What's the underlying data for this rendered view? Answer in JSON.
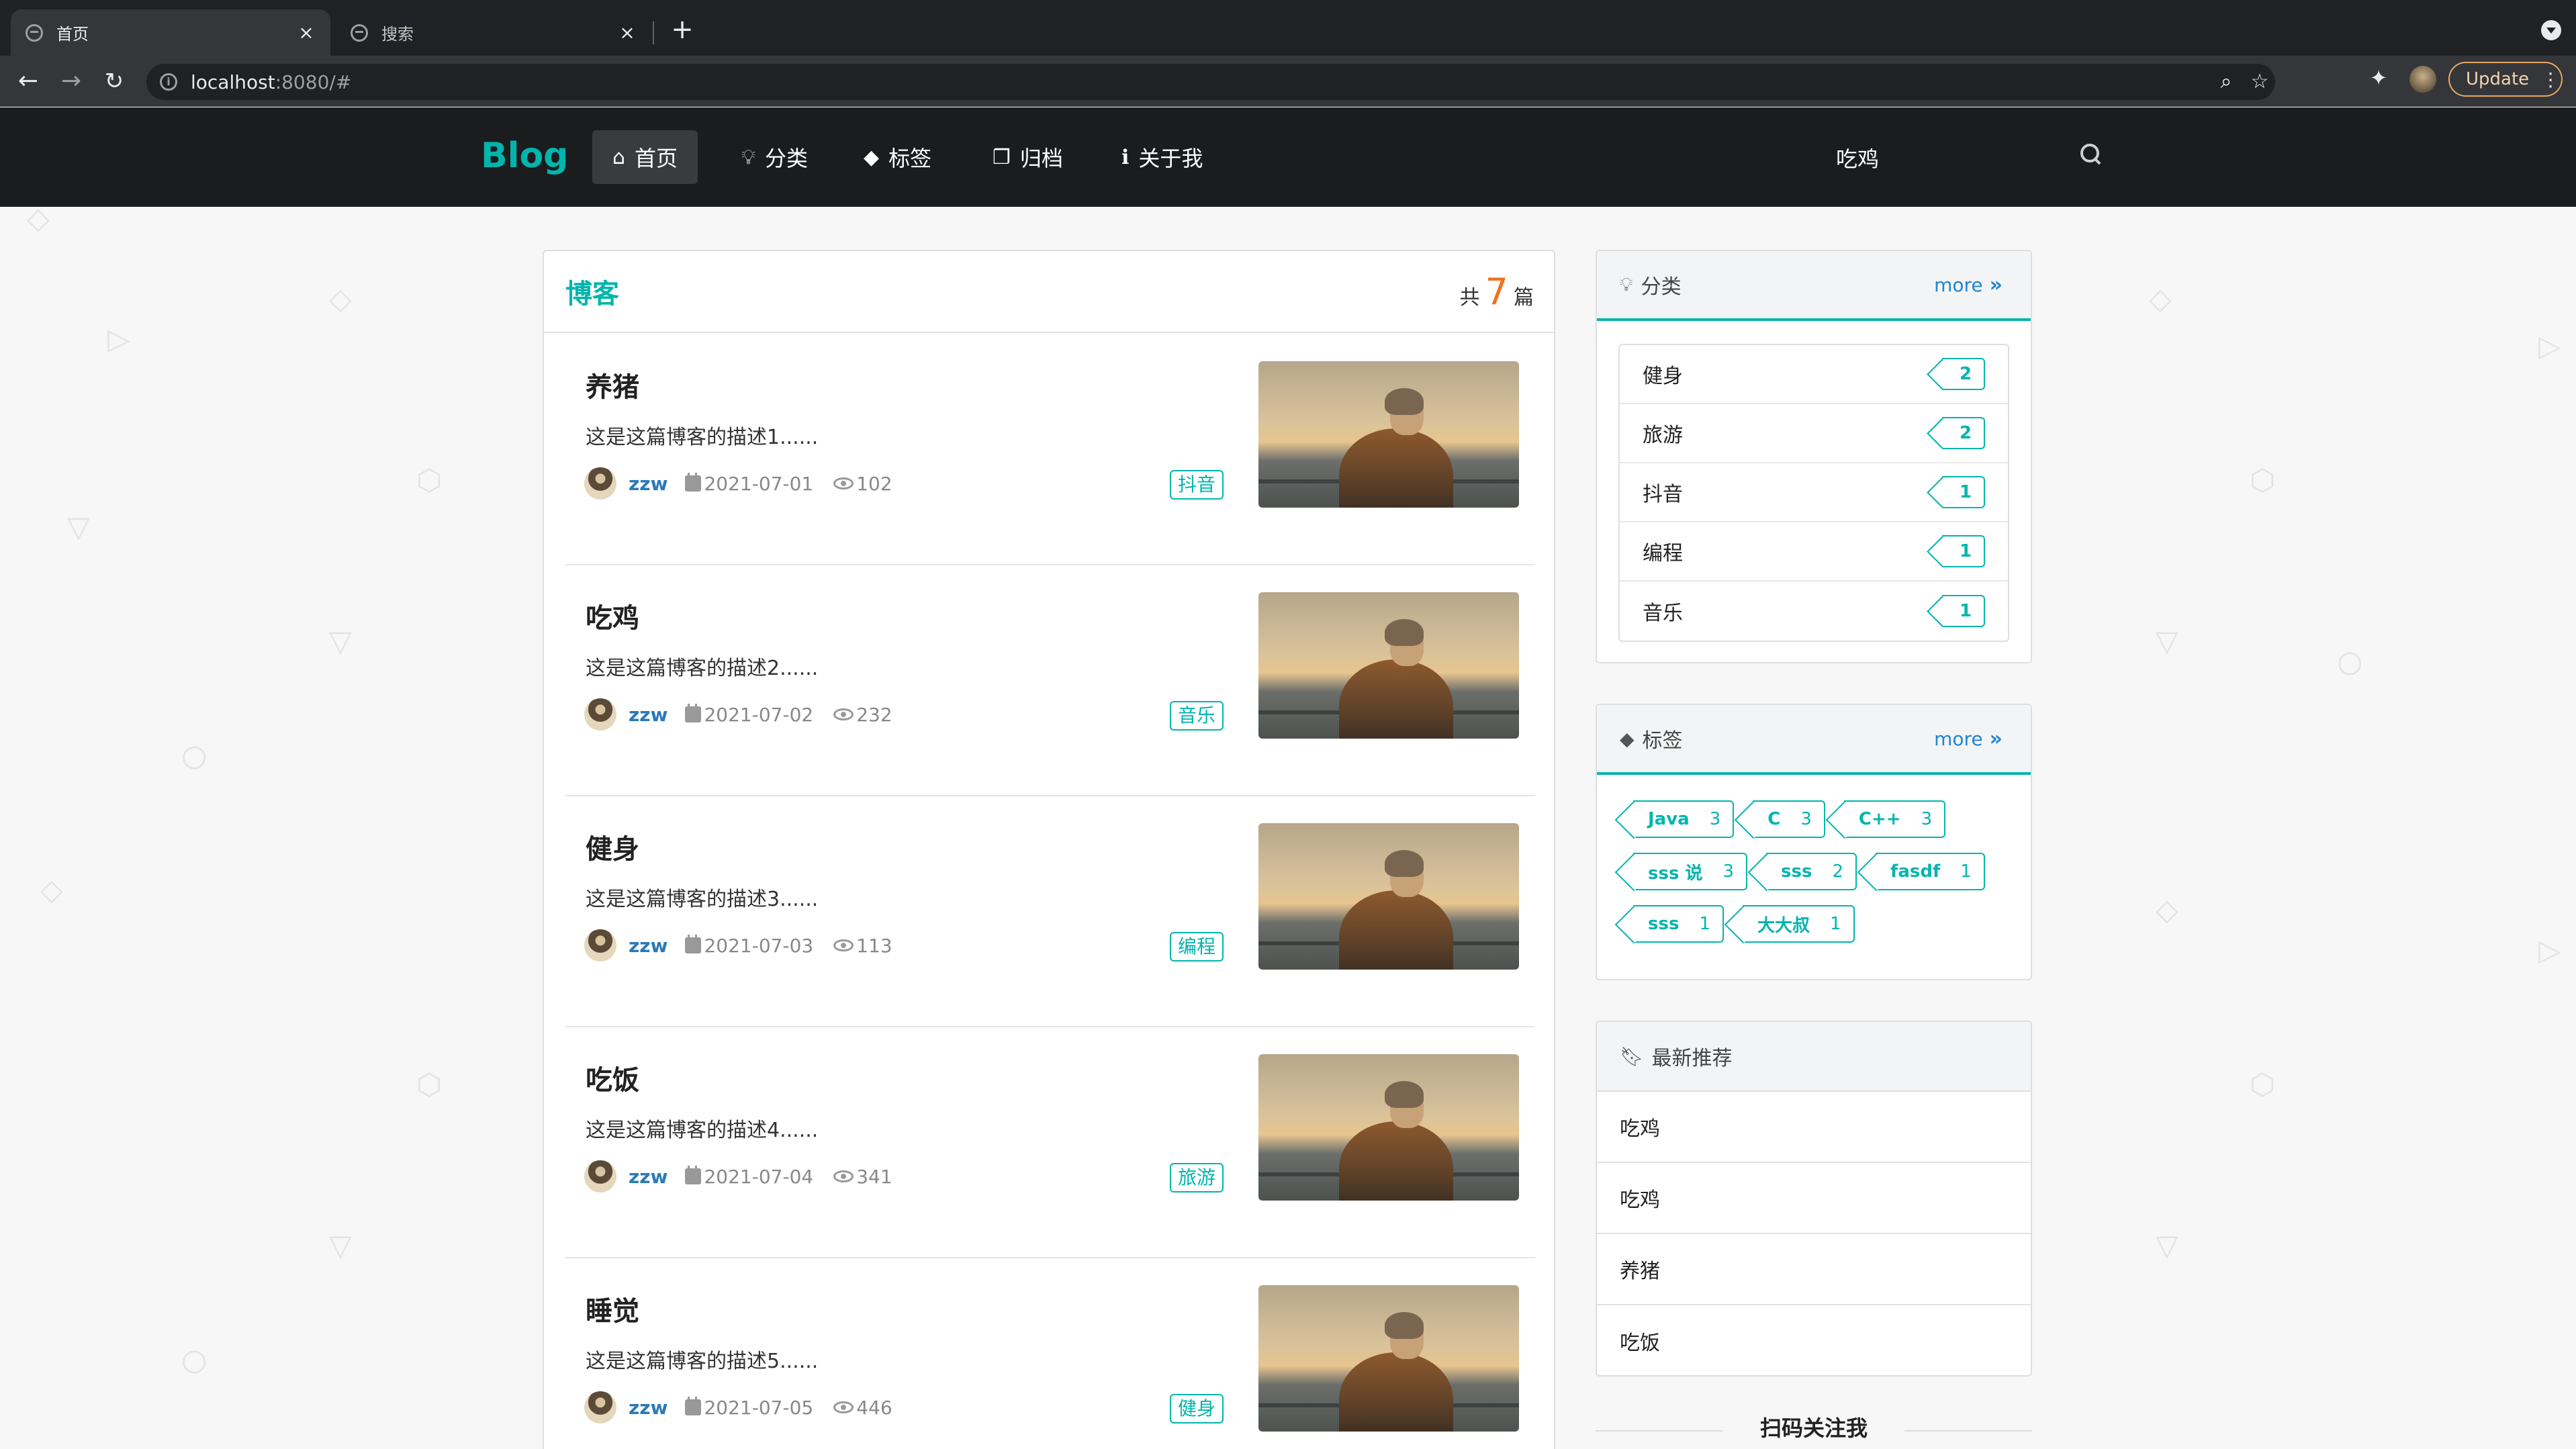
{
  "browser": {
    "tabs": [
      {
        "title": "首页",
        "active": true
      },
      {
        "title": "搜索",
        "active": false
      }
    ],
    "url_host": "localhost",
    "url_rest": ":8080/#",
    "update_label": "Update"
  },
  "nav": {
    "brand": "Blog",
    "items": [
      {
        "label": "首页",
        "icon": "home-icon",
        "active": true
      },
      {
        "label": "分类",
        "icon": "lightbulb-icon",
        "active": false
      },
      {
        "label": "标签",
        "icon": "tags-icon",
        "active": false
      },
      {
        "label": "归档",
        "icon": "clone-icon",
        "active": false
      },
      {
        "label": "关于我",
        "icon": "info-icon",
        "active": false
      }
    ],
    "search_value": "吃鸡"
  },
  "main": {
    "title": "博客",
    "count_prefix": "共",
    "count": "7",
    "count_suffix": "篇",
    "posts": [
      {
        "title": "养猪",
        "desc": "这是这篇博客的描述1......",
        "author": "zzw",
        "date": "2021-07-01",
        "views": "102",
        "tag": "抖音"
      },
      {
        "title": "吃鸡",
        "desc": "这是这篇博客的描述2......",
        "author": "zzw",
        "date": "2021-07-02",
        "views": "232",
        "tag": "音乐"
      },
      {
        "title": "健身",
        "desc": "这是这篇博客的描述3......",
        "author": "zzw",
        "date": "2021-07-03",
        "views": "113",
        "tag": "编程"
      },
      {
        "title": "吃饭",
        "desc": "这是这篇博客的描述4......",
        "author": "zzw",
        "date": "2021-07-04",
        "views": "341",
        "tag": "旅游"
      },
      {
        "title": "睡觉",
        "desc": "这是这篇博客的描述5......",
        "author": "zzw",
        "date": "2021-07-05",
        "views": "446",
        "tag": "健身"
      }
    ]
  },
  "sidebar": {
    "categories": {
      "title": "分类",
      "more": "more",
      "items": [
        {
          "name": "健身",
          "count": "2"
        },
        {
          "name": "旅游",
          "count": "2"
        },
        {
          "name": "抖音",
          "count": "1"
        },
        {
          "name": "编程",
          "count": "1"
        },
        {
          "name": "音乐",
          "count": "1"
        }
      ]
    },
    "tags": {
      "title": "标签",
      "more": "more",
      "items": [
        {
          "name": "Java",
          "count": "3"
        },
        {
          "name": "C",
          "count": "3"
        },
        {
          "name": "C++",
          "count": "3"
        },
        {
          "name": "sss 说",
          "count": "3"
        },
        {
          "name": "sss",
          "count": "2"
        },
        {
          "name": "fasdf",
          "count": "1"
        },
        {
          "name": "sss",
          "count": "1"
        },
        {
          "name": "大大叔",
          "count": "1"
        }
      ]
    },
    "recommend": {
      "title": "最新推荐",
      "items": [
        "吃鸡",
        "吃鸡",
        "养猪",
        "吃饭"
      ]
    },
    "qr_title": "扫码关注我"
  },
  "colors": {
    "accent": "#00b5ad",
    "count_orange": "#f2711c",
    "link_blue": "#2185d0",
    "navbar_bg": "#1b1c1d"
  }
}
